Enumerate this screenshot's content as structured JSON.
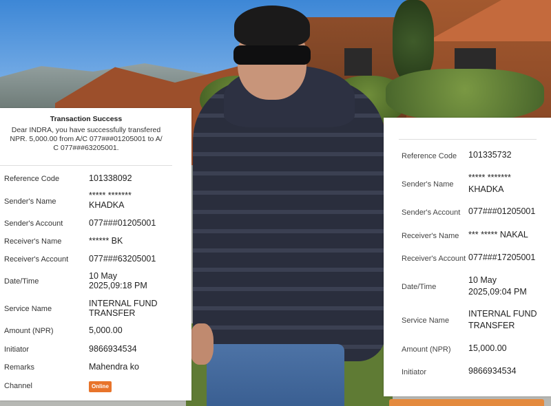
{
  "left_receipt": {
    "title": "Transaction Success",
    "message_line1": "Dear INDRA, you have successfully transfered",
    "message_line2": "NPR. 5,000.00 from A/C 077###01205001 to A/",
    "message_line3": "C 077###63205001.",
    "rows": [
      {
        "label": "Reference Code",
        "value": "101338092"
      },
      {
        "label": "Sender's Name",
        "value_line1": "***** *******",
        "value_line2": "KHADKA"
      },
      {
        "label": "Sender's Account",
        "value": "077###01205001"
      },
      {
        "label": "Receiver's Name",
        "value": "****** BK"
      },
      {
        "label": "Receiver's Account",
        "value": "077###63205001"
      },
      {
        "label": "Date/Time",
        "value_line1": "10 May",
        "value_line2": "2025,09:18 PM"
      },
      {
        "label": "Service Name",
        "value_line1": "INTERNAL FUND",
        "value_line2": "TRANSFER"
      },
      {
        "label": "Amount (NPR)",
        "value": "5,000.00"
      },
      {
        "label": "Initiator",
        "value": "9866934534"
      },
      {
        "label": "Remarks",
        "value": "Mahendra ko"
      },
      {
        "label": "Channel",
        "value": "Online"
      }
    ],
    "badge_color": "#e8742b"
  },
  "right_receipt": {
    "rows": [
      {
        "label": "Reference Code",
        "value": "101335732"
      },
      {
        "label": "Sender's Name",
        "value_line1": "***** *******",
        "value_line2": "KHADKA"
      },
      {
        "label": "Sender's Account",
        "value": "077###01205001"
      },
      {
        "label": "Receiver's Name",
        "value": "*** ***** NAKAL"
      },
      {
        "label": "Receiver's Account",
        "value": "077###17205001"
      },
      {
        "label": "Date/Time",
        "value_line1": "10 May",
        "value_line2": "2025,09:04 PM"
      },
      {
        "label": "Service Name",
        "value_line1": "INTERNAL FUND",
        "value_line2": "TRANSFER"
      },
      {
        "label": "Amount (NPR)",
        "value": "15,000.00"
      },
      {
        "label": "Initiator",
        "value": "9866934534"
      }
    ],
    "accent_color": "#e48a3e"
  }
}
